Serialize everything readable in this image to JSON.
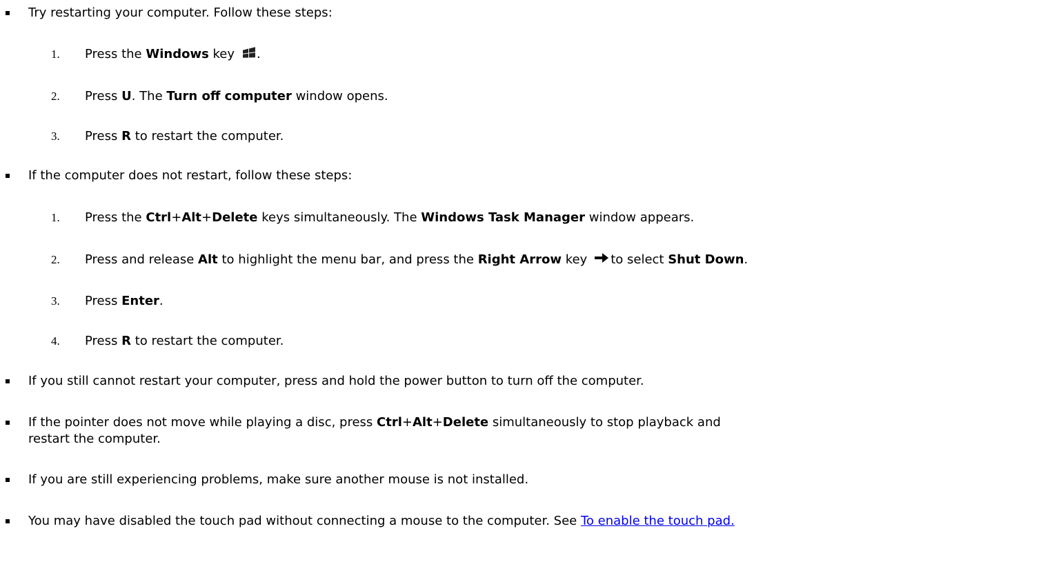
{
  "items": [
    {
      "text": "Try restarting your computer. Follow these steps:"
    },
    {
      "steps": [
        {
          "num": "1.",
          "a": "Press the ",
          "b1": "Windows",
          "c": " key",
          "icon": "windows-logo-icon",
          "d": "."
        },
        {
          "num": "2.",
          "a": "Press ",
          "b1": "U",
          "c": ". The ",
          "b2": "Turn off computer",
          "d": " window opens."
        },
        {
          "num": "3.",
          "a": "Press ",
          "b1": "R",
          "c": " to restart the computer."
        }
      ]
    },
    {
      "text": "If the computer does not restart, follow these steps:"
    },
    {
      "steps": [
        {
          "num": "1.",
          "a": "Press the ",
          "b1": "Ctrl",
          "p1": "+",
          "b2": "Alt",
          "p2": "+",
          "b3": "Delete",
          "c": " keys simultaneously. The ",
          "b4": "Windows Task Manager",
          "d": " window appears."
        },
        {
          "num": "2.",
          "a": "Press and release ",
          "b1": "Alt",
          "c": " to highlight the menu bar, and press the ",
          "b2": "Right Arrow",
          "e": " key",
          "icon": "right-arrow-icon",
          "f": "to select ",
          "b3": "Shut Down",
          "d": "."
        },
        {
          "num": "3.",
          "a": "Press ",
          "b1": "Enter",
          "d": "."
        },
        {
          "num": "4.",
          "a": "Press ",
          "b1": "R",
          "c": " to restart the computer."
        }
      ]
    },
    {
      "text": "If you still cannot restart your computer, press and hold the power button to turn off the computer."
    },
    {
      "a": "If the pointer does not move while playing a disc, press ",
      "b1": "Ctrl",
      "p1": "+",
      "b2": "Alt",
      "p2": "+",
      "b3": "Delete",
      "c": " simultaneously to stop playback and",
      "line2": "restart the computer."
    },
    {
      "text": "If you are still experiencing problems, make sure another mouse is not installed."
    },
    {
      "a": "You may have disabled the touch pad without connecting a mouse to the computer. See ",
      "link": "To enable the touch pad."
    }
  ]
}
